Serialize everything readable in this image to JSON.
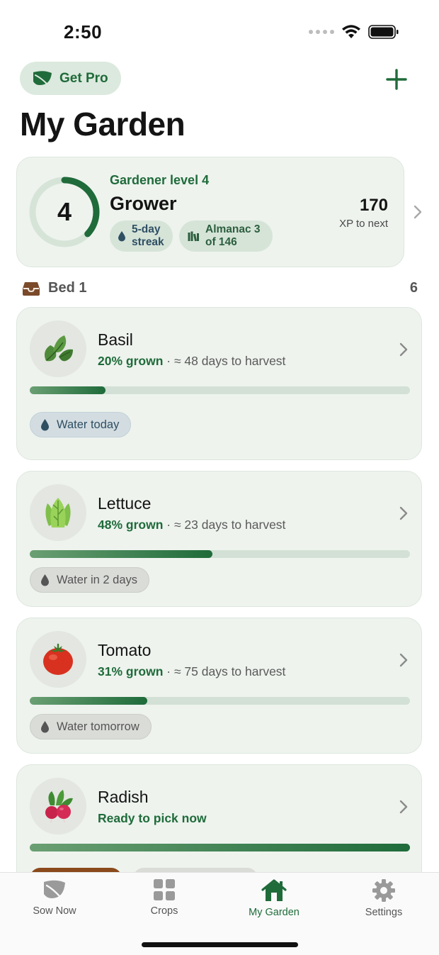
{
  "status_bar": {
    "time": "2:50"
  },
  "header": {
    "pro_label": "Get Pro",
    "title": "My Garden"
  },
  "level_card": {
    "level": "4",
    "level_progress": 0.37,
    "caption": "Gardener level 4",
    "name": "Grower",
    "streak_line1": "5-day",
    "streak_line2": "streak",
    "almanac_line1": "Almanac 3",
    "almanac_line2": "of 146",
    "xp_value": "170",
    "xp_caption": "XP to next"
  },
  "bed": {
    "name": "Bed 1",
    "count": "6"
  },
  "plants": [
    {
      "name": "Basil",
      "growth": "20% grown",
      "detail": " · ≈ 48 days to harvest",
      "progress": 0.2,
      "water": "Water today"
    },
    {
      "name": "Lettuce",
      "growth": "48% grown",
      "detail": " · ≈ 23 days to harvest",
      "progress": 0.48,
      "water": "Water in 2 days"
    },
    {
      "name": "Tomato",
      "growth": "31% grown",
      "detail": " · ≈ 75 days to harvest",
      "progress": 0.31,
      "water": "Water tomorrow"
    },
    {
      "name": "Radish",
      "growth": "Ready to pick now",
      "detail": "",
      "progress": 1.0
    }
  ],
  "tabs": [
    {
      "label": "Sow Now"
    },
    {
      "label": "Crops"
    },
    {
      "label": "My Garden"
    },
    {
      "label": "Settings"
    }
  ],
  "colors": {
    "accent": "#1f6b3a",
    "card_bg": "#eef3ee",
    "water_blue": "#2f4f63"
  }
}
